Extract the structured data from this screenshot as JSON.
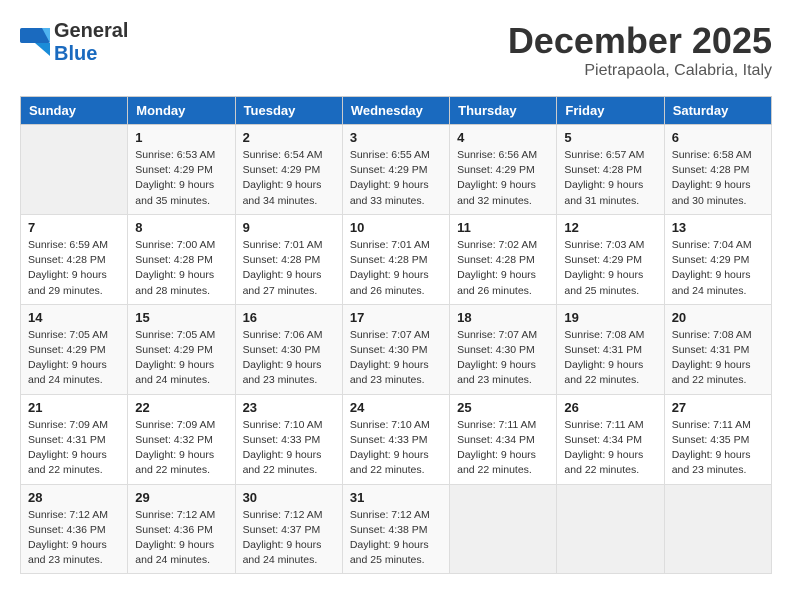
{
  "header": {
    "logo_general": "General",
    "logo_blue": "Blue",
    "month": "December 2025",
    "location": "Pietrapaola, Calabria, Italy"
  },
  "weekdays": [
    "Sunday",
    "Monday",
    "Tuesday",
    "Wednesday",
    "Thursday",
    "Friday",
    "Saturday"
  ],
  "weeks": [
    [
      {
        "day": "",
        "sunrise": "",
        "sunset": "",
        "daylight": "",
        "empty": true
      },
      {
        "day": "1",
        "sunrise": "Sunrise: 6:53 AM",
        "sunset": "Sunset: 4:29 PM",
        "daylight": "Daylight: 9 hours and 35 minutes."
      },
      {
        "day": "2",
        "sunrise": "Sunrise: 6:54 AM",
        "sunset": "Sunset: 4:29 PM",
        "daylight": "Daylight: 9 hours and 34 minutes."
      },
      {
        "day": "3",
        "sunrise": "Sunrise: 6:55 AM",
        "sunset": "Sunset: 4:29 PM",
        "daylight": "Daylight: 9 hours and 33 minutes."
      },
      {
        "day": "4",
        "sunrise": "Sunrise: 6:56 AM",
        "sunset": "Sunset: 4:29 PM",
        "daylight": "Daylight: 9 hours and 32 minutes."
      },
      {
        "day": "5",
        "sunrise": "Sunrise: 6:57 AM",
        "sunset": "Sunset: 4:28 PM",
        "daylight": "Daylight: 9 hours and 31 minutes."
      },
      {
        "day": "6",
        "sunrise": "Sunrise: 6:58 AM",
        "sunset": "Sunset: 4:28 PM",
        "daylight": "Daylight: 9 hours and 30 minutes."
      }
    ],
    [
      {
        "day": "7",
        "sunrise": "Sunrise: 6:59 AM",
        "sunset": "Sunset: 4:28 PM",
        "daylight": "Daylight: 9 hours and 29 minutes."
      },
      {
        "day": "8",
        "sunrise": "Sunrise: 7:00 AM",
        "sunset": "Sunset: 4:28 PM",
        "daylight": "Daylight: 9 hours and 28 minutes."
      },
      {
        "day": "9",
        "sunrise": "Sunrise: 7:01 AM",
        "sunset": "Sunset: 4:28 PM",
        "daylight": "Daylight: 9 hours and 27 minutes."
      },
      {
        "day": "10",
        "sunrise": "Sunrise: 7:01 AM",
        "sunset": "Sunset: 4:28 PM",
        "daylight": "Daylight: 9 hours and 26 minutes."
      },
      {
        "day": "11",
        "sunrise": "Sunrise: 7:02 AM",
        "sunset": "Sunset: 4:28 PM",
        "daylight": "Daylight: 9 hours and 26 minutes."
      },
      {
        "day": "12",
        "sunrise": "Sunrise: 7:03 AM",
        "sunset": "Sunset: 4:29 PM",
        "daylight": "Daylight: 9 hours and 25 minutes."
      },
      {
        "day": "13",
        "sunrise": "Sunrise: 7:04 AM",
        "sunset": "Sunset: 4:29 PM",
        "daylight": "Daylight: 9 hours and 24 minutes."
      }
    ],
    [
      {
        "day": "14",
        "sunrise": "Sunrise: 7:05 AM",
        "sunset": "Sunset: 4:29 PM",
        "daylight": "Daylight: 9 hours and 24 minutes."
      },
      {
        "day": "15",
        "sunrise": "Sunrise: 7:05 AM",
        "sunset": "Sunset: 4:29 PM",
        "daylight": "Daylight: 9 hours and 24 minutes."
      },
      {
        "day": "16",
        "sunrise": "Sunrise: 7:06 AM",
        "sunset": "Sunset: 4:30 PM",
        "daylight": "Daylight: 9 hours and 23 minutes."
      },
      {
        "day": "17",
        "sunrise": "Sunrise: 7:07 AM",
        "sunset": "Sunset: 4:30 PM",
        "daylight": "Daylight: 9 hours and 23 minutes."
      },
      {
        "day": "18",
        "sunrise": "Sunrise: 7:07 AM",
        "sunset": "Sunset: 4:30 PM",
        "daylight": "Daylight: 9 hours and 23 minutes."
      },
      {
        "day": "19",
        "sunrise": "Sunrise: 7:08 AM",
        "sunset": "Sunset: 4:31 PM",
        "daylight": "Daylight: 9 hours and 22 minutes."
      },
      {
        "day": "20",
        "sunrise": "Sunrise: 7:08 AM",
        "sunset": "Sunset: 4:31 PM",
        "daylight": "Daylight: 9 hours and 22 minutes."
      }
    ],
    [
      {
        "day": "21",
        "sunrise": "Sunrise: 7:09 AM",
        "sunset": "Sunset: 4:31 PM",
        "daylight": "Daylight: 9 hours and 22 minutes."
      },
      {
        "day": "22",
        "sunrise": "Sunrise: 7:09 AM",
        "sunset": "Sunset: 4:32 PM",
        "daylight": "Daylight: 9 hours and 22 minutes."
      },
      {
        "day": "23",
        "sunrise": "Sunrise: 7:10 AM",
        "sunset": "Sunset: 4:33 PM",
        "daylight": "Daylight: 9 hours and 22 minutes."
      },
      {
        "day": "24",
        "sunrise": "Sunrise: 7:10 AM",
        "sunset": "Sunset: 4:33 PM",
        "daylight": "Daylight: 9 hours and 22 minutes."
      },
      {
        "day": "25",
        "sunrise": "Sunrise: 7:11 AM",
        "sunset": "Sunset: 4:34 PM",
        "daylight": "Daylight: 9 hours and 22 minutes."
      },
      {
        "day": "26",
        "sunrise": "Sunrise: 7:11 AM",
        "sunset": "Sunset: 4:34 PM",
        "daylight": "Daylight: 9 hours and 22 minutes."
      },
      {
        "day": "27",
        "sunrise": "Sunrise: 7:11 AM",
        "sunset": "Sunset: 4:35 PM",
        "daylight": "Daylight: 9 hours and 23 minutes."
      }
    ],
    [
      {
        "day": "28",
        "sunrise": "Sunrise: 7:12 AM",
        "sunset": "Sunset: 4:36 PM",
        "daylight": "Daylight: 9 hours and 23 minutes."
      },
      {
        "day": "29",
        "sunrise": "Sunrise: 7:12 AM",
        "sunset": "Sunset: 4:36 PM",
        "daylight": "Daylight: 9 hours and 24 minutes."
      },
      {
        "day": "30",
        "sunrise": "Sunrise: 7:12 AM",
        "sunset": "Sunset: 4:37 PM",
        "daylight": "Daylight: 9 hours and 24 minutes."
      },
      {
        "day": "31",
        "sunrise": "Sunrise: 7:12 AM",
        "sunset": "Sunset: 4:38 PM",
        "daylight": "Daylight: 9 hours and 25 minutes."
      },
      {
        "day": "",
        "sunrise": "",
        "sunset": "",
        "daylight": "",
        "empty": true
      },
      {
        "day": "",
        "sunrise": "",
        "sunset": "",
        "daylight": "",
        "empty": true
      },
      {
        "day": "",
        "sunrise": "",
        "sunset": "",
        "daylight": "",
        "empty": true
      }
    ]
  ]
}
